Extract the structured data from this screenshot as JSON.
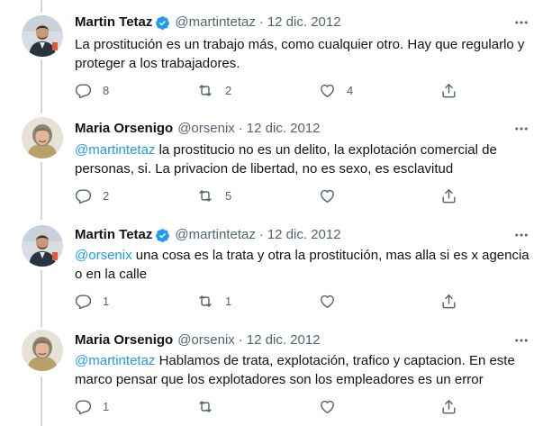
{
  "tweets": [
    {
      "author": "Martin Tetaz",
      "handle": "@martintetaz",
      "separator": "·",
      "date": "12 dic. 2012",
      "verified": true,
      "mention": "",
      "text": "La prostitución es un trabajo más, como cualquier otro. Hay que regularlo y proteger a los trabajadores.",
      "replies": "8",
      "retweets": "2",
      "likes": "4"
    },
    {
      "author": "Maria Orsenigo",
      "handle": "@orsenix",
      "separator": "·",
      "date": "12 dic. 2012",
      "verified": false,
      "mention": "@martintetaz",
      "text": " la prostitucio no es un delito, la explotación comercial de personas, si. La privacion de libertad, no es sexo, es esclavitud",
      "replies": "2",
      "retweets": "5",
      "likes": ""
    },
    {
      "author": "Martin Tetaz",
      "handle": "@martintetaz",
      "separator": "·",
      "date": "12 dic. 2012",
      "verified": true,
      "mention": "@orsenix",
      "text": " una cosa es la trata y otra la prostitución, mas alla si es x agencia o en la calle",
      "replies": "1",
      "retweets": "1",
      "likes": ""
    },
    {
      "author": "Maria Orsenigo",
      "handle": "@orsenix",
      "separator": "·",
      "date": "12 dic. 2012",
      "verified": false,
      "mention": "@martintetaz",
      "text": " Hablamos de trata, explotación, trafico y captacion. En este marco pensar que los explotadores son los empleadores es un error",
      "replies": "1",
      "retweets": "",
      "likes": ""
    }
  ],
  "colors": {
    "accent": "#1d9bf0",
    "text": "#0f1419",
    "secondary": "#536471",
    "thread_line": "#cfd9de"
  },
  "icons": {
    "verified": "verified-badge-icon",
    "more": "more-options-icon",
    "reply": "reply-icon",
    "retweet": "retweet-icon",
    "like": "like-icon",
    "share": "share-icon"
  }
}
